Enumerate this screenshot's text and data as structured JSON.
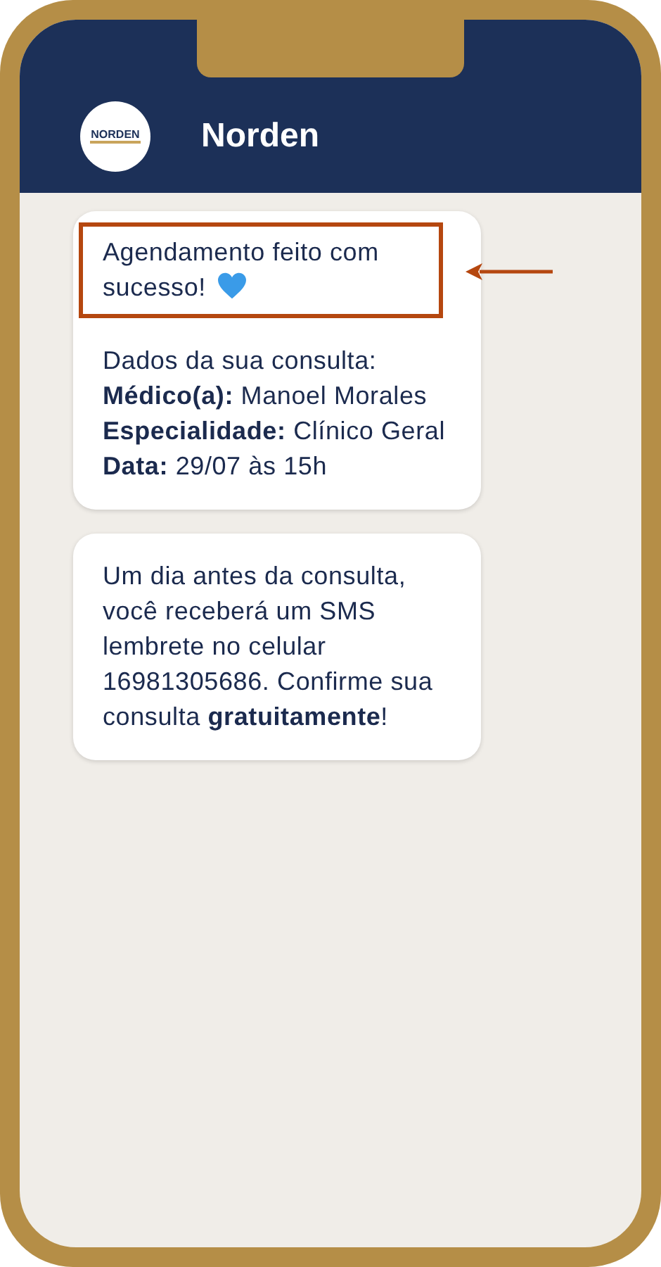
{
  "header": {
    "logo_text": "NORDEN",
    "title": "Norden"
  },
  "messages": [
    {
      "kind": "details",
      "highlight": {
        "text": "Agendamento feito com sucesso!",
        "highlighted": true
      },
      "lines": [
        "Dados da sua consulta:",
        "**Médico(a):** Manoel Morales",
        "**Especialidade:** Clínico Geral",
        "**Data:** 29/07 às 15h"
      ]
    },
    {
      "kind": "plain",
      "text": "Um dia antes da consulta, você receberá um SMS lembrete no celular 16981305686. Confirme sua consulta **gratuitamente**!"
    }
  ]
}
